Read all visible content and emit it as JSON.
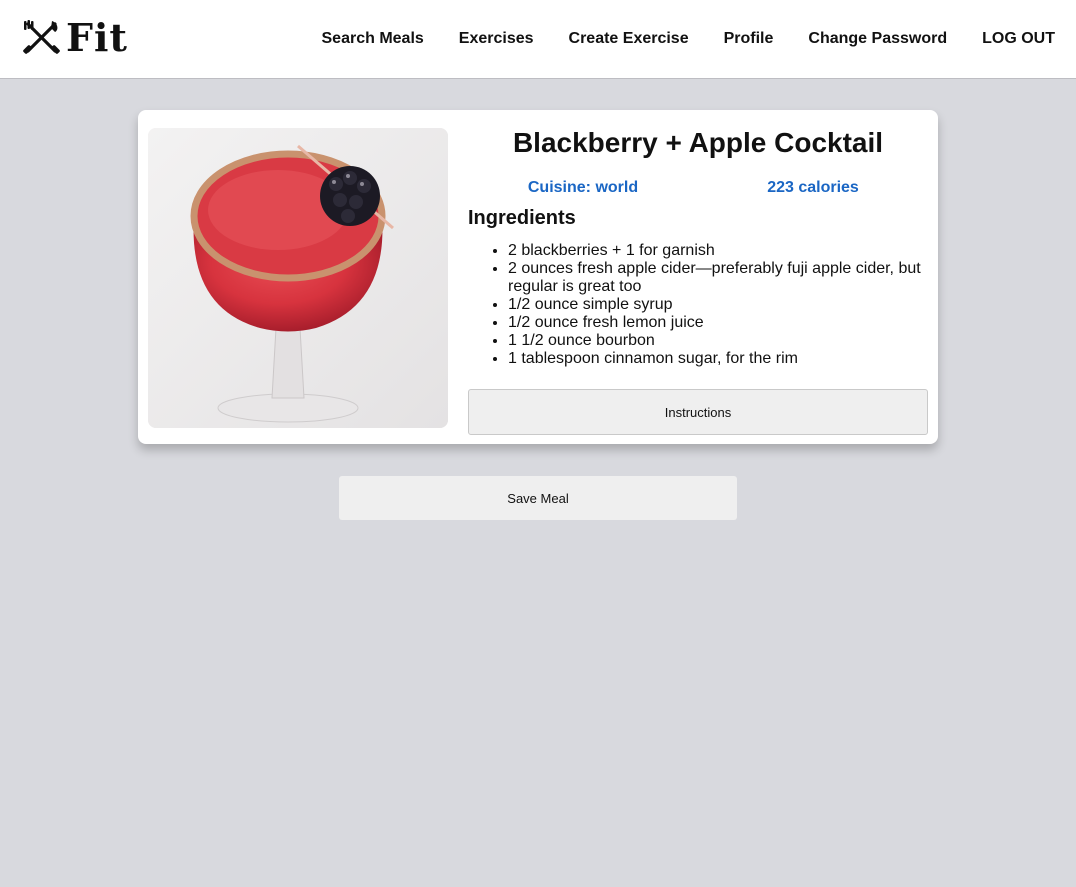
{
  "header": {
    "logo_text": "Fit",
    "logo_icon": "fork-knife-dumbbell-icon",
    "nav": [
      {
        "label": "Search Meals"
      },
      {
        "label": "Exercises"
      },
      {
        "label": "Create Exercise"
      },
      {
        "label": "Profile"
      },
      {
        "label": "Change Password"
      },
      {
        "label": "LOG OUT"
      }
    ]
  },
  "meal": {
    "title": "Blackberry + Apple Cocktail",
    "cuisine": "Cuisine: world",
    "calories": "223 calories",
    "ingredients_heading": "Ingredients",
    "ingredients": [
      "2 blackberries + 1 for garnish",
      "2 ounces fresh apple cider—preferably fuji apple cider, but regular is great too",
      "1/2 ounce simple syrup",
      "1/2 ounce fresh lemon juice",
      "1 1/2 ounce bourbon",
      "1 tablespoon cinnamon sugar, for the rim"
    ],
    "instructions_label": "Instructions"
  },
  "actions": {
    "save_label": "Save Meal"
  },
  "colors": {
    "accent": "#1a66c4",
    "page_bg": "#d8d9de"
  }
}
